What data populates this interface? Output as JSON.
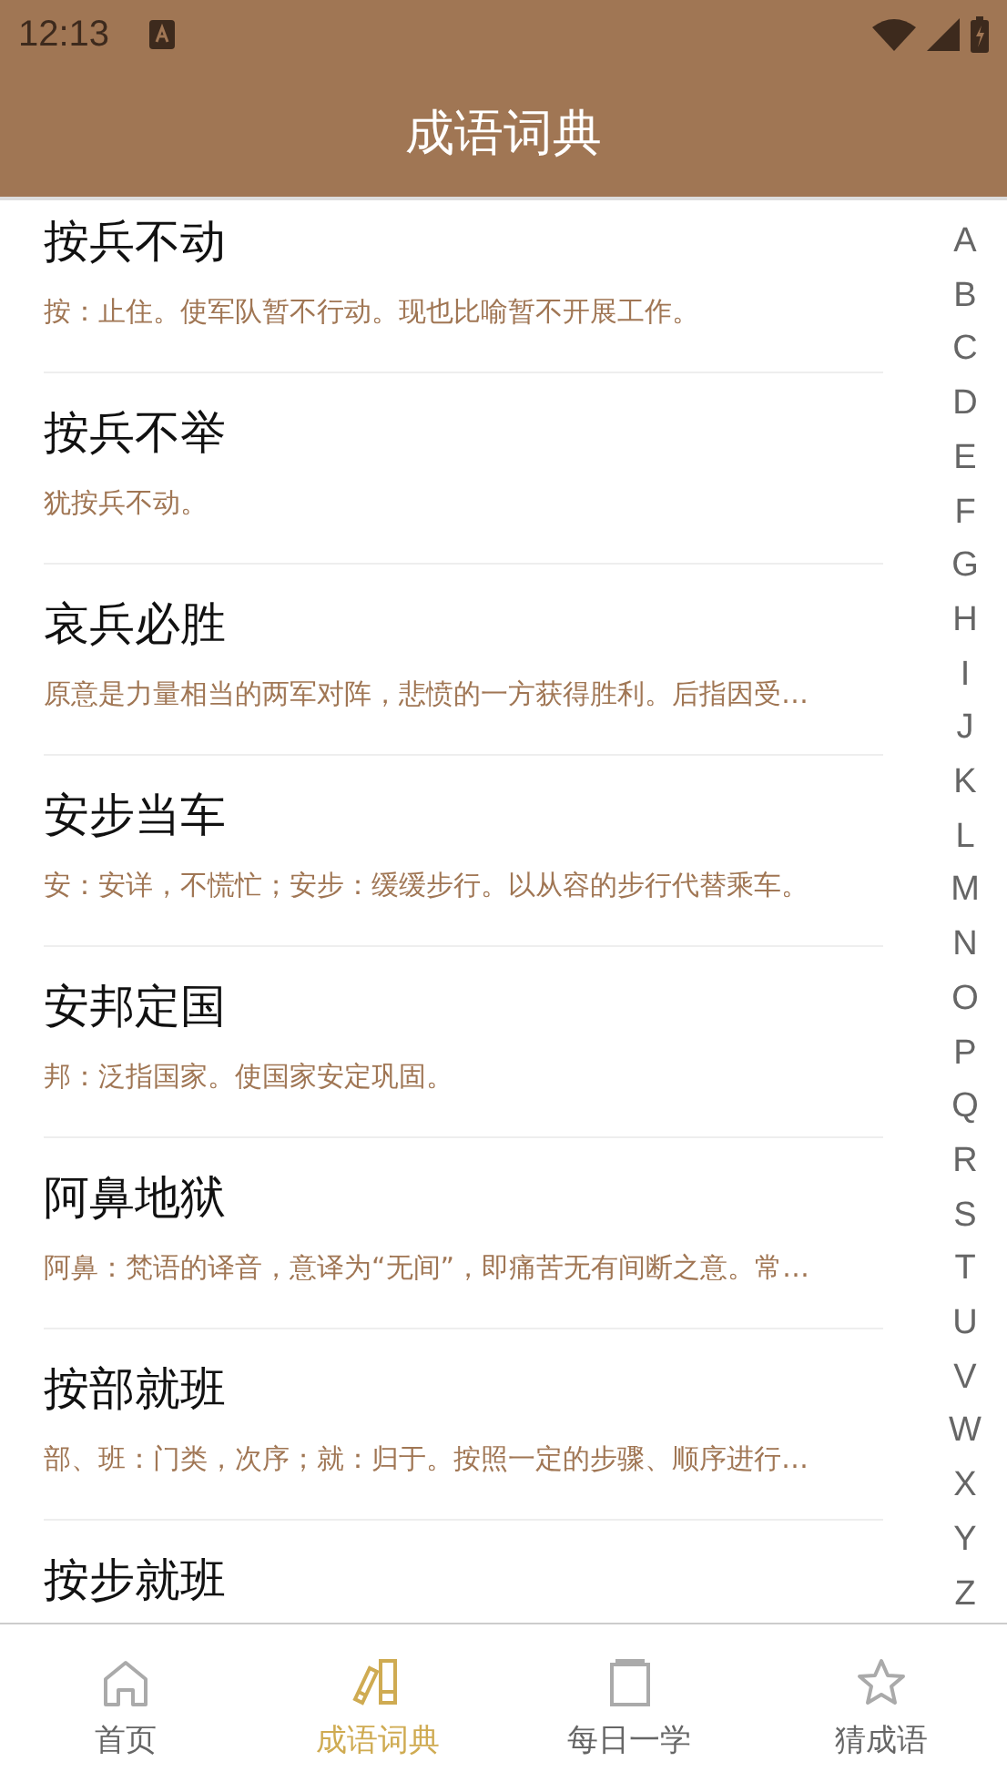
{
  "status_bar": {
    "time": "12:13"
  },
  "app_bar": {
    "title": "成语词典"
  },
  "idioms": [
    {
      "title": "按兵不动",
      "description": "按：止住。使军队暂不行动。现也比喻暂不开展工作。"
    },
    {
      "title": "按兵不举",
      "description": "犹按兵不动。"
    },
    {
      "title": "哀兵必胜",
      "description": "原意是力量相当的两军对阵，悲愤的一方获得胜利。后指因受…"
    },
    {
      "title": "安步当车",
      "description": "安：安详，不慌忙；安步：缓缓步行。以从容的步行代替乘车。"
    },
    {
      "title": "安邦定国",
      "description": "邦：泛指国家。使国家安定巩固。"
    },
    {
      "title": "阿鼻地狱",
      "description": "阿鼻：梵语的译音，意译为“无间”，即痛苦无有间断之意。常…"
    },
    {
      "title": "按部就班",
      "description": "部、班：门类，次序；就：归于。按照一定的步骤、顺序进行…"
    },
    {
      "title": "按步就班"
    }
  ],
  "index_letters": [
    "A",
    "B",
    "C",
    "D",
    "E",
    "F",
    "G",
    "H",
    "I",
    "J",
    "K",
    "L",
    "M",
    "N",
    "O",
    "P",
    "Q",
    "R",
    "S",
    "T",
    "U",
    "V",
    "W",
    "X",
    "Y",
    "Z"
  ],
  "tabs": [
    {
      "kind": "home",
      "label": "首页",
      "selected": false
    },
    {
      "kind": "books",
      "label": "成语词典",
      "selected": true
    },
    {
      "kind": "page",
      "label": "每日一学",
      "selected": false
    },
    {
      "kind": "star",
      "label": "猜成语",
      "selected": false
    }
  ]
}
